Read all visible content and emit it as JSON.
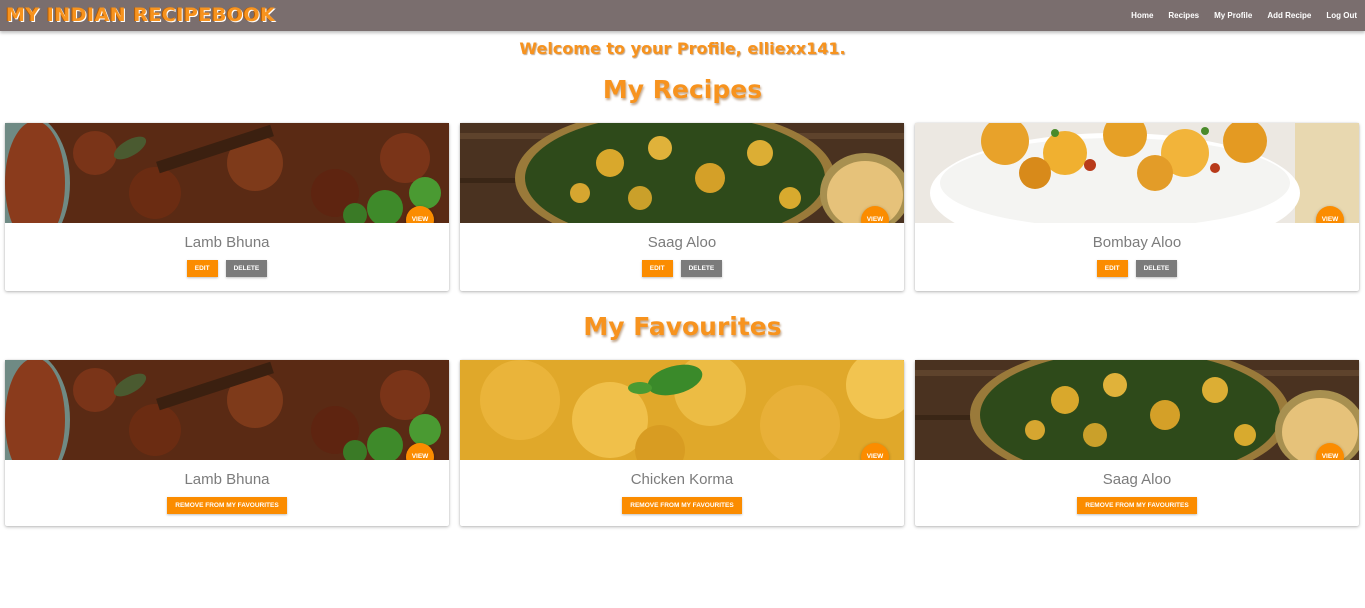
{
  "header": {
    "brand": "My Indian RecipeBook",
    "nav": [
      "Home",
      "Recipes",
      "My Profile",
      "Add Recipe",
      "Log Out"
    ]
  },
  "welcome": "Welcome to your Profile, elliexx141.",
  "my_recipes": {
    "title": "My Recipes",
    "items": [
      {
        "name": "Lamb Bhuna",
        "view": "VIEW",
        "edit": "EDIT",
        "delete": "DELETE"
      },
      {
        "name": "Saag Aloo",
        "view": "VIEW",
        "edit": "EDIT",
        "delete": "DELETE"
      },
      {
        "name": "Bombay Aloo",
        "view": "VIEW",
        "edit": "EDIT",
        "delete": "DELETE"
      }
    ]
  },
  "my_favourites": {
    "title": "My Favourites",
    "items": [
      {
        "name": "Lamb Bhuna",
        "view": "VIEW",
        "remove": "REMOVE FROM MY FAVOURITES"
      },
      {
        "name": "Chicken Korma",
        "view": "VIEW",
        "remove": "REMOVE FROM MY FAVOURITES"
      },
      {
        "name": "Saag Aloo",
        "view": "VIEW",
        "remove": "REMOVE FROM MY FAVOURITES"
      }
    ]
  },
  "colors": {
    "accent": "#f7931e",
    "button_orange": "#fb8c00",
    "button_grey": "#7b7b7b",
    "navbar": "#7a6e6e"
  }
}
